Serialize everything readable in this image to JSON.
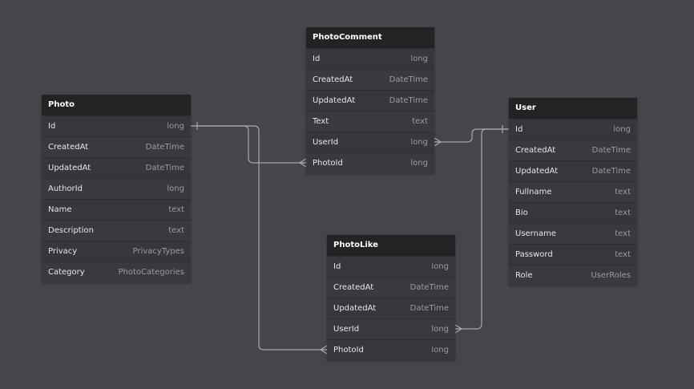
{
  "colors": {
    "canvas": "#45454c",
    "entity_body": "#36363d",
    "entity_header": "#232325",
    "field_name": "#e6e6ea",
    "field_type": "#9a9aa2",
    "connector": "#a8a8b0"
  },
  "entities": {
    "photo": {
      "title": "Photo",
      "fields": [
        {
          "name": "Id",
          "type": "long"
        },
        {
          "name": "CreatedAt",
          "type": "DateTime"
        },
        {
          "name": "UpdatedAt",
          "type": "DateTime"
        },
        {
          "name": "AuthorId",
          "type": "long"
        },
        {
          "name": "Name",
          "type": "text"
        },
        {
          "name": "Description",
          "type": "text"
        },
        {
          "name": "Privacy",
          "type": "PrivacyTypes"
        },
        {
          "name": "Category",
          "type": "PhotoCategories"
        }
      ]
    },
    "photo_comment": {
      "title": "PhotoComment",
      "fields": [
        {
          "name": "Id",
          "type": "long"
        },
        {
          "name": "CreatedAt",
          "type": "DateTime"
        },
        {
          "name": "UpdatedAt",
          "type": "DateTime"
        },
        {
          "name": "Text",
          "type": "text"
        },
        {
          "name": "UserId",
          "type": "long"
        },
        {
          "name": "PhotoId",
          "type": "long"
        }
      ]
    },
    "photo_like": {
      "title": "PhotoLike",
      "fields": [
        {
          "name": "Id",
          "type": "long"
        },
        {
          "name": "CreatedAt",
          "type": "DateTime"
        },
        {
          "name": "UpdatedAt",
          "type": "DateTime"
        },
        {
          "name": "UserId",
          "type": "long"
        },
        {
          "name": "PhotoId",
          "type": "long"
        }
      ]
    },
    "user": {
      "title": "User",
      "fields": [
        {
          "name": "Id",
          "type": "long"
        },
        {
          "name": "CreatedAt",
          "type": "DateTime"
        },
        {
          "name": "UpdatedAt",
          "type": "DateTime"
        },
        {
          "name": "Fullname",
          "type": "text"
        },
        {
          "name": "Bio",
          "type": "text"
        },
        {
          "name": "Username",
          "type": "text"
        },
        {
          "name": "Password",
          "type": "text"
        },
        {
          "name": "Role",
          "type": "UserRoles"
        }
      ]
    }
  },
  "relationships": [
    {
      "from": "photo.Id",
      "to": "photo_comment.PhotoId",
      "cardinality": "one-to-many"
    },
    {
      "from": "photo.Id",
      "to": "photo_like.PhotoId",
      "cardinality": "one-to-many"
    },
    {
      "from": "user.Id",
      "to": "photo_comment.UserId",
      "cardinality": "one-to-many"
    },
    {
      "from": "user.Id",
      "to": "photo_like.UserId",
      "cardinality": "one-to-many"
    }
  ]
}
